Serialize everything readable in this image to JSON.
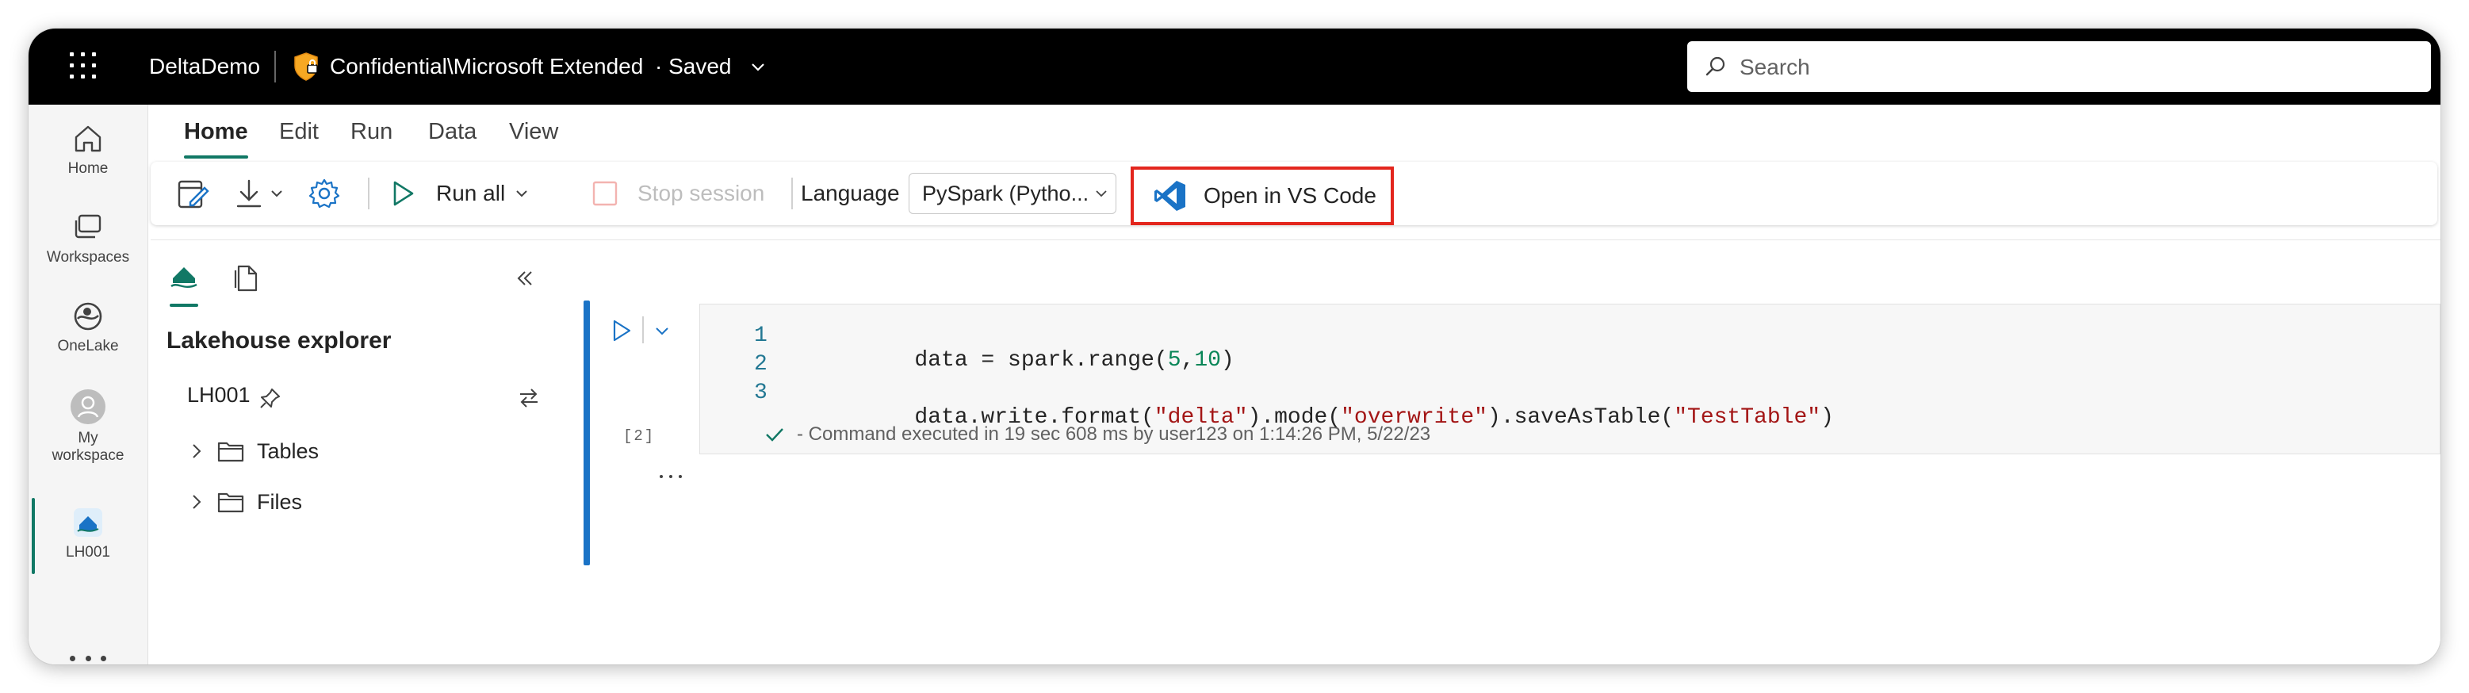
{
  "topbar": {
    "app_name": "DeltaDemo",
    "sensitivity_label": "Confidential\\Microsoft Extended",
    "save_status": "· Saved",
    "search_placeholder": "Search",
    "search_value": ""
  },
  "rail": {
    "items": [
      {
        "label": "Home",
        "icon": "home-icon"
      },
      {
        "label": "Workspaces",
        "icon": "workspaces-icon"
      },
      {
        "label": "OneLake",
        "icon": "onelake-icon"
      },
      {
        "label_line1": "My",
        "label_line2": "workspace",
        "icon": "avatar-icon"
      },
      {
        "label": "LH001",
        "icon": "lakehouse-icon",
        "active": true
      }
    ],
    "more_icon": "more-icon"
  },
  "menu_tabs": [
    "Home",
    "Edit",
    "Run",
    "Data",
    "View"
  ],
  "toolbar": {
    "run_all_label": "Run all",
    "stop_session_label": "Stop session",
    "language_label": "Language",
    "language_value": "PySpark (Pytho...",
    "open_vscode_label": "Open in VS Code"
  },
  "explorer": {
    "title": "Lakehouse explorer",
    "lakehouse_name": "LH001",
    "tree": [
      {
        "label": "Tables"
      },
      {
        "label": "Files"
      }
    ]
  },
  "cell": {
    "execution_count": "[2]",
    "lines": [
      {
        "num": "1",
        "text": "data = spark.range(5,10)"
      },
      {
        "num": "2",
        "text": ""
      },
      {
        "num": "3",
        "text": "data.write.format(\"delta\").mode(\"overwrite\").saveAsTable(\"TestTable\")"
      }
    ],
    "status_text": "- Command executed in 19 sec 608 ms by user123 on 1:14:26 PM, 5/22/23"
  },
  "colors": {
    "accent": "#117865",
    "highlight_border": "#e3261d",
    "cell_bar": "#1a73c6"
  }
}
